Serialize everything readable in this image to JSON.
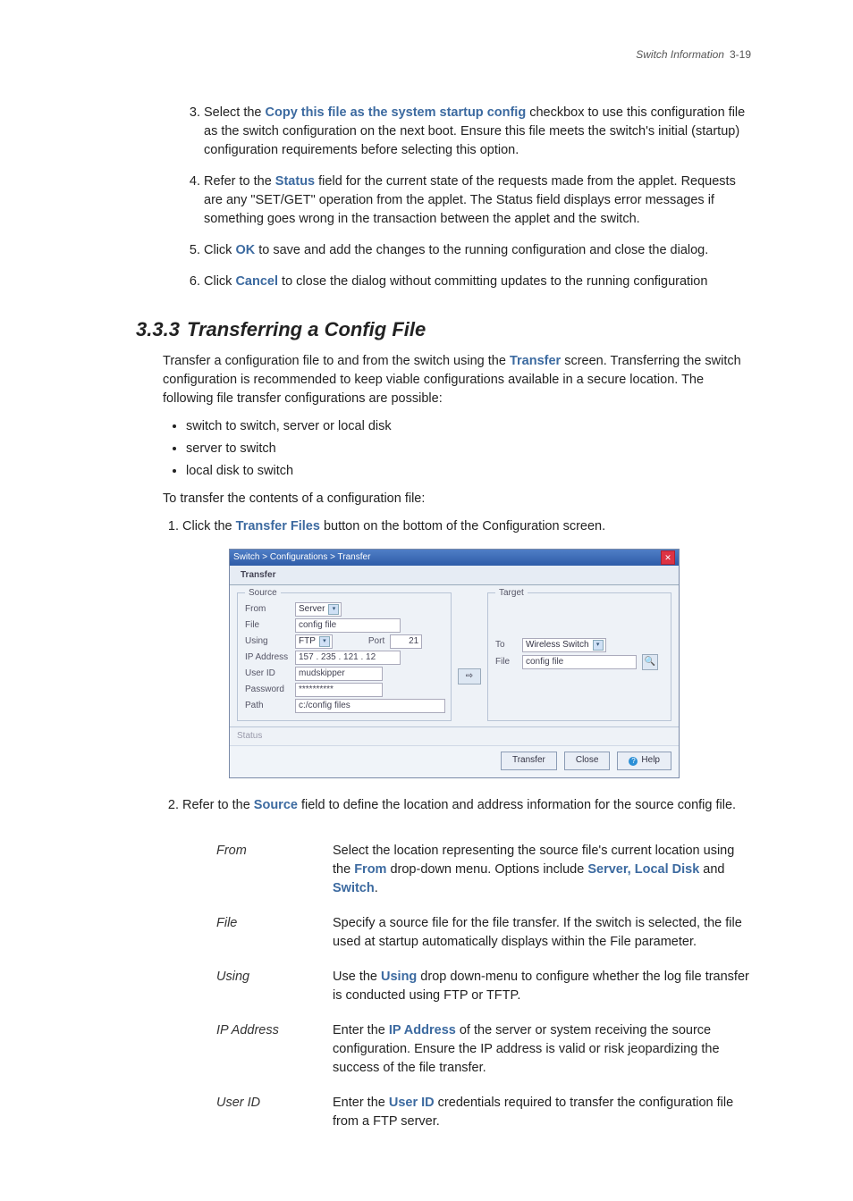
{
  "header": {
    "title": "Switch Information",
    "page": "3-19"
  },
  "steps_a": [
    {
      "pre": "Select the ",
      "bold": "Copy this file as the system startup config",
      "post": " checkbox to use this configuration file as the switch configuration on the next boot. Ensure this file meets the switch's initial (startup) configuration requirements before selecting this option."
    },
    {
      "pre": "Refer to the ",
      "bold": "Status",
      "post": " field for the current state of the requests made from the applet. Requests are any \"SET/GET\" operation from the applet. The Status field displays error messages if something goes wrong in the transaction between the applet and the switch."
    },
    {
      "pre": "Click ",
      "bold": "OK",
      "post": " to save and add the changes to the running configuration and close the dialog."
    },
    {
      "pre": "Click ",
      "bold": "Cancel",
      "post": " to close the dialog without committing updates to the running configuration"
    }
  ],
  "section": {
    "no": "3.3.3",
    "title": "Transferring a Config File"
  },
  "intro": {
    "pre": "Transfer a configuration file to and from the switch using the ",
    "bold": "Transfer",
    "post": " screen. Transferring the switch configuration is recommended to keep viable configurations available in a secure location. The following file transfer configurations are possible:"
  },
  "bullets": [
    "switch to switch, server or local disk",
    "server to switch",
    "local disk to switch"
  ],
  "intro2": "To transfer the contents of a configuration file:",
  "sub1": {
    "pre": "Click the ",
    "bold": "Transfer Files",
    "post": " button on the bottom of the Configuration screen."
  },
  "dlg": {
    "breadcrumb": "Switch > Configurations > Transfer",
    "tab": "Transfer",
    "source": {
      "legend": "Source",
      "from_label": "From",
      "from_value": "Server",
      "file_label": "File",
      "file_value": "config file",
      "using_label": "Using",
      "using_value": "FTP",
      "port_label": "Port",
      "port_value": "21",
      "ip_label": "IP Address",
      "ip_value": "157 . 235 . 121 . 12",
      "uid_label": "User ID",
      "uid_value": "mudskipper",
      "pw_label": "Password",
      "pw_value": "**********",
      "path_label": "Path",
      "path_value": "c:/config files"
    },
    "target": {
      "legend": "Target",
      "to_label": "To",
      "to_value": "Wireless Switch",
      "file_label": "File",
      "file_value": "config file"
    },
    "status_label": "Status",
    "buttons": {
      "transfer": "Transfer",
      "close": "Close",
      "help": "Help"
    }
  },
  "sub2": {
    "pre": "Refer to the ",
    "bold": "Source",
    "post": " field to define the location and address information for the source config file."
  },
  "defs": [
    {
      "term": "From",
      "pre": "Select the location representing the source file's current location using the ",
      "b1": "From",
      "mid": " drop-down menu. Options include ",
      "b2": "Server, Local Disk",
      "mid2": " and ",
      "b3": "Switch",
      "post": "."
    },
    {
      "term": "File",
      "pre": "Specify a source file for the file transfer. If the switch is selected, the file used at startup automatically displays within the File parameter.",
      "b1": "",
      "mid": "",
      "b2": "",
      "mid2": "",
      "b3": "",
      "post": ""
    },
    {
      "term": "Using",
      "pre": "Use the ",
      "b1": "Using",
      "mid": " drop down-menu to configure whether the log file transfer is conducted using FTP or TFTP.",
      "b2": "",
      "mid2": "",
      "b3": "",
      "post": ""
    },
    {
      "term": "IP Address",
      "pre": "Enter the ",
      "b1": "IP Address",
      "mid": " of the server or system receiving the source configuration. Ensure the IP address is valid or risk jeopardizing the success of the file transfer.",
      "b2": "",
      "mid2": "",
      "b3": "",
      "post": ""
    },
    {
      "term": "User ID",
      "pre": "Enter the ",
      "b1": "User ID",
      "mid": " credentials required to transfer the configuration file from a FTP server.",
      "b2": "",
      "mid2": "",
      "b3": "",
      "post": ""
    }
  ]
}
